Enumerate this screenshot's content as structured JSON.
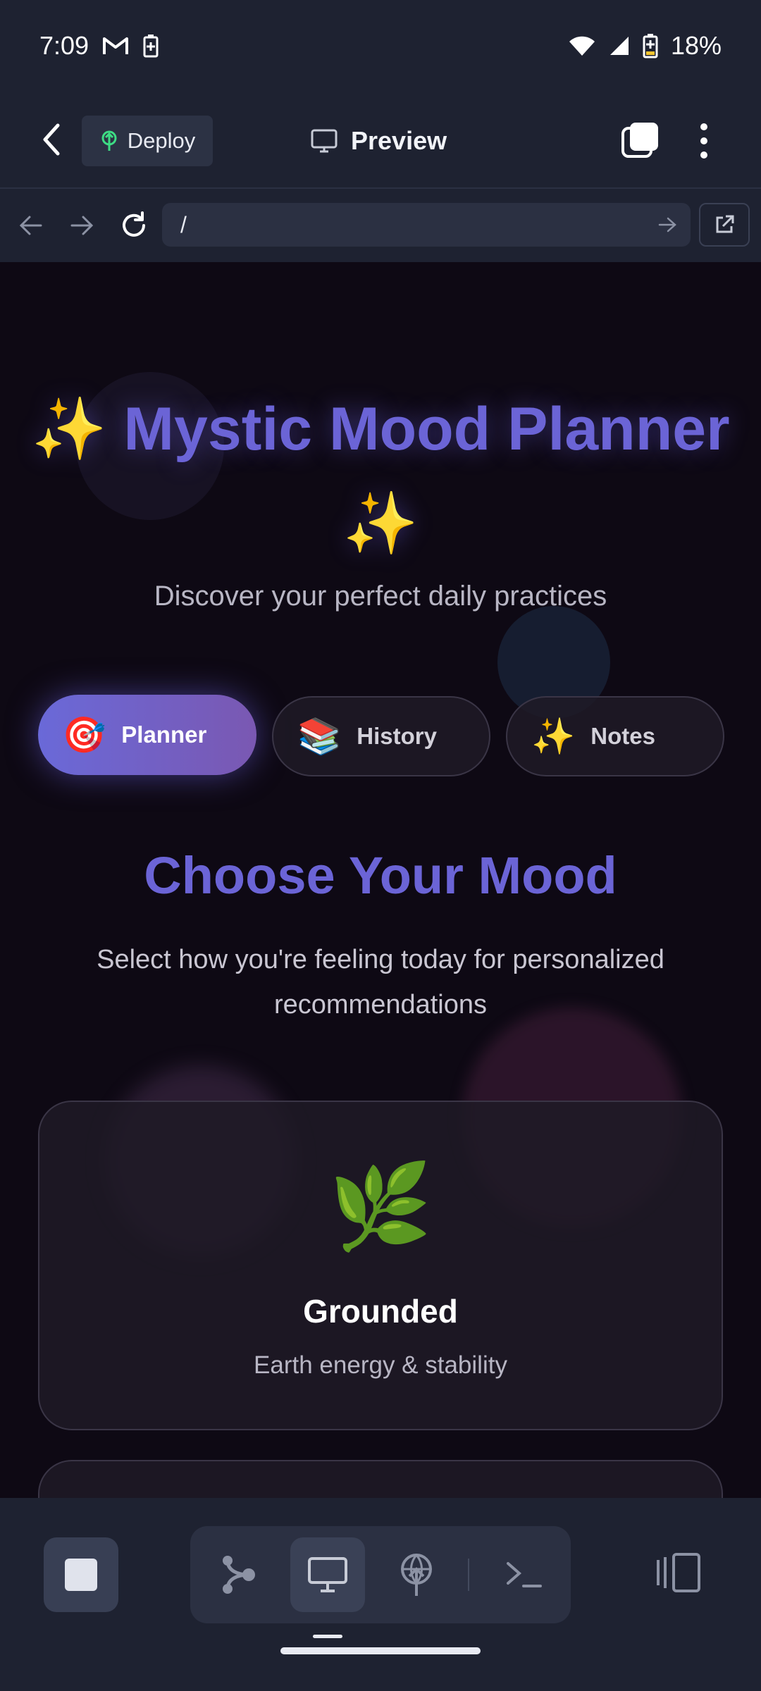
{
  "status_bar": {
    "time": "7:09",
    "battery": "18%"
  },
  "header": {
    "deploy_label": "Deploy",
    "preview_label": "Preview"
  },
  "url_bar": {
    "url": "/"
  },
  "hero": {
    "title": "✨ Mystic Mood Planner ✨",
    "subtitle": "Discover your perfect daily practices"
  },
  "tabs": [
    {
      "emoji": "🎯",
      "label": "Planner",
      "active": true
    },
    {
      "emoji": "📚",
      "label": "History",
      "active": false
    },
    {
      "emoji": "✨",
      "label": "Notes",
      "active": false
    }
  ],
  "section": {
    "title": "Choose Your Mood",
    "subtitle": "Select how you're feeling today for personalized recommendations"
  },
  "moods": [
    {
      "emoji": "🌿",
      "name": "Grounded",
      "description": "Earth energy & stability"
    }
  ],
  "colors": {
    "accent": "#6b64d6",
    "tab_gradient_start": "#6a69d8",
    "tab_gradient_end": "#7a58b2",
    "background": "#0e0914",
    "chrome": "#1e2231"
  }
}
